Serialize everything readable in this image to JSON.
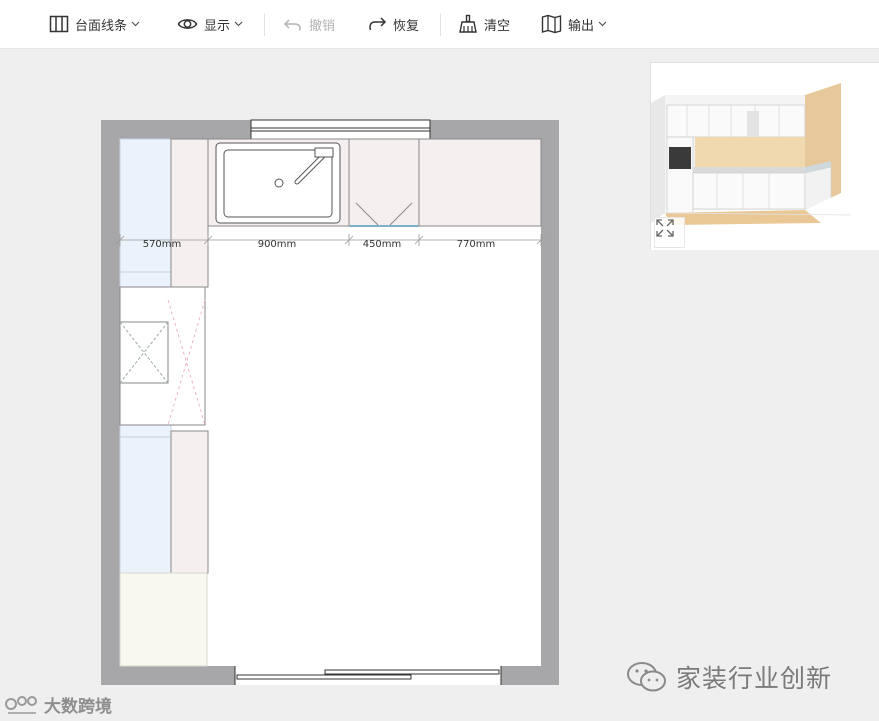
{
  "toolbar": {
    "countertop_line": "台面线条",
    "display": "显示",
    "undo": "撤销",
    "redo": "恢复",
    "clear": "清空",
    "export": "输出"
  },
  "plan": {
    "dimensions": [
      "570mm",
      "900mm",
      "450mm",
      "770mm"
    ]
  },
  "watermark": {
    "right": "家装行业创新",
    "left": "大数跨境"
  },
  "icons": {
    "countertop_line": "layout-columns-icon",
    "display": "eye-icon",
    "undo": "undo-icon",
    "redo": "redo-icon",
    "clear": "broom-icon",
    "export": "book-open-icon",
    "expand": "expand-icon"
  },
  "colors": {
    "wall": "#a7a6a8",
    "cabinet_blue": "#eaf2fb",
    "cabinet_pink": "#f6efef",
    "toolbar_text": "#333333",
    "disabled_text": "#b3b3b3"
  }
}
